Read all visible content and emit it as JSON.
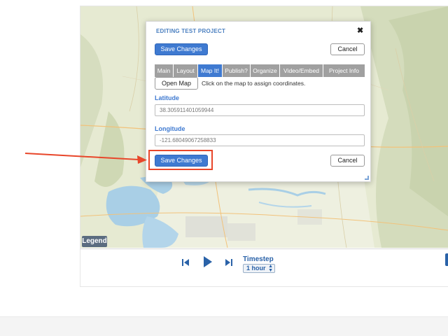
{
  "modal": {
    "title": "EDITING TEST PROJECT",
    "close_glyph": "✖",
    "save_label": "Save Changes",
    "cancel_label": "Cancel",
    "tabs": [
      {
        "label": "Main",
        "active": false
      },
      {
        "label": "Layout",
        "active": false
      },
      {
        "label": "Map It!",
        "active": true
      },
      {
        "label": "Publish?",
        "active": false
      },
      {
        "label": "Organize",
        "active": false
      },
      {
        "label": "Video/Embed",
        "active": false
      },
      {
        "label": "Project Info",
        "active": false
      }
    ],
    "open_map_label": "Open Map",
    "open_map_hint": "Click on the map to assign coordinates.",
    "latitude_label": "Latitude",
    "latitude_value": "38.305911401059944",
    "longitude_label": "Longitude",
    "longitude_value": "-121.68049067258833"
  },
  "map": {
    "legend_label": "Legend"
  },
  "player": {
    "timestep_label": "Timestep",
    "timestep_value": "1 hour",
    "icons": [
      "skip-back-icon",
      "play-icon",
      "skip-forward-icon"
    ]
  },
  "annotation": {
    "color": "#e8462a",
    "target": "save-bottom-button"
  },
  "colors": {
    "primary": "#3f7ad1",
    "tab_inactive": "#a0a0a0",
    "player_accent": "#2a62a8"
  }
}
